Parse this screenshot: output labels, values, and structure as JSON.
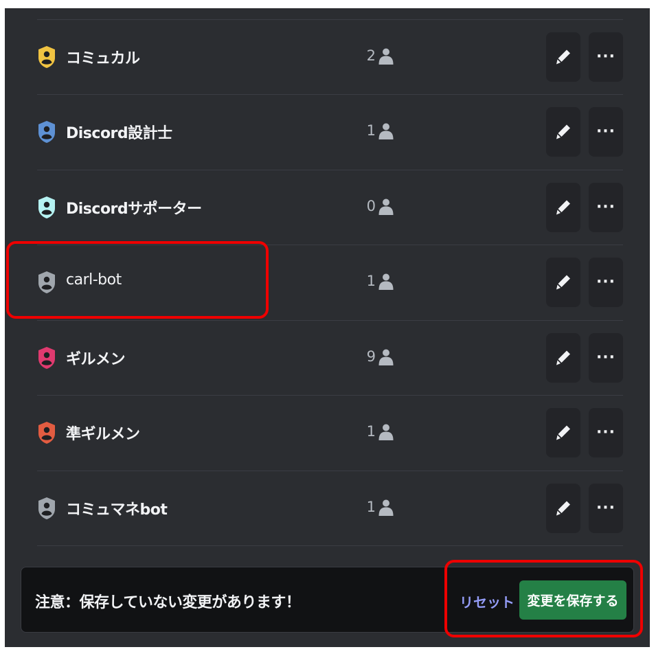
{
  "roles": [
    {
      "name": "コミュカル",
      "count": "2",
      "color": "#f0c342"
    },
    {
      "name": "Discord設計士",
      "count": "1",
      "color": "#5e91d4"
    },
    {
      "name": "Discordサポーター",
      "count": "0",
      "color": "#b5f2f2"
    },
    {
      "name": "carl-bot",
      "count": "1",
      "color": "#a0a6ad"
    },
    {
      "name": "ギルメン",
      "count": "9",
      "color": "#e03a6f"
    },
    {
      "name": "準ギルメン",
      "count": "1",
      "color": "#e25c41"
    },
    {
      "name": "コミュマネbot",
      "count": "1",
      "color": "#a0a6ad"
    }
  ],
  "row_actions": {
    "edit_icon": "pencil-icon",
    "more_label": "···"
  },
  "notice": {
    "message": "注意：保存していない変更があります！",
    "reset_label": "リセット",
    "save_label": "変更を保存する"
  },
  "colors": {
    "background": "#2b2d31",
    "save_button": "#248046",
    "reset_link": "#949cf7",
    "highlight": "#ee0000"
  }
}
